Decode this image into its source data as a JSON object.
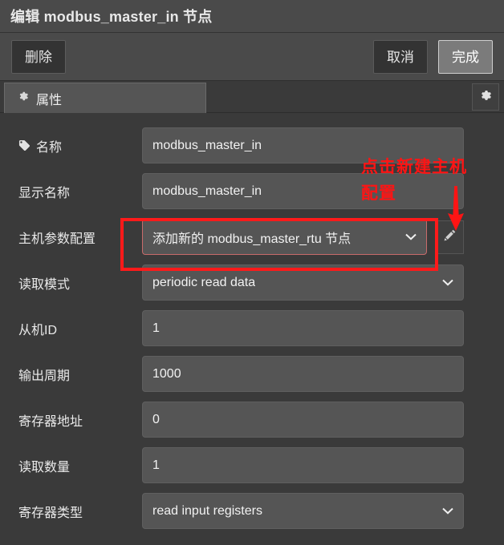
{
  "titlebar": {
    "title": "编辑 modbus_master_in 节点"
  },
  "buttons": {
    "delete": "删除",
    "cancel": "取消",
    "done": "完成"
  },
  "tabs": {
    "properties": {
      "label": "属性",
      "icon": "gear-icon"
    },
    "settings_icon": "gear-icon"
  },
  "form": {
    "fields": [
      {
        "key": "name",
        "label": "名称",
        "icon": "tag-icon",
        "type": "text",
        "value": "modbus_master_in"
      },
      {
        "key": "display_name",
        "label": "显示名称",
        "type": "text",
        "value": "modbus_master_in"
      },
      {
        "key": "host_config",
        "label": "主机参数配置",
        "type": "select",
        "value": "添加新的 modbus_master_rtu 节点",
        "edit_icon": "pencil-icon",
        "highlighted": true
      },
      {
        "key": "read_mode",
        "label": "读取模式",
        "type": "select",
        "value": "periodic read data"
      },
      {
        "key": "slave_id",
        "label": "从机ID",
        "type": "text",
        "value": "1"
      },
      {
        "key": "output_period",
        "label": "输出周期",
        "type": "text",
        "value": "1000"
      },
      {
        "key": "register_address",
        "label": "寄存器地址",
        "type": "text",
        "value": "0"
      },
      {
        "key": "read_quantity",
        "label": "读取数量",
        "type": "text",
        "value": "1"
      },
      {
        "key": "register_type",
        "label": "寄存器类型",
        "type": "select",
        "value": "read input registers"
      }
    ]
  },
  "annotation": {
    "line1": "点击新建主机",
    "line2": "配置",
    "arrow": "down-arrow",
    "color": "#ff1414"
  },
  "colors": {
    "dialog_bg": "#3a3a3a",
    "header_bg": "#4a4a4a",
    "input_bg": "#555555",
    "accent_red": "#ff1a1a",
    "done_btn": "#7b7b7b"
  }
}
